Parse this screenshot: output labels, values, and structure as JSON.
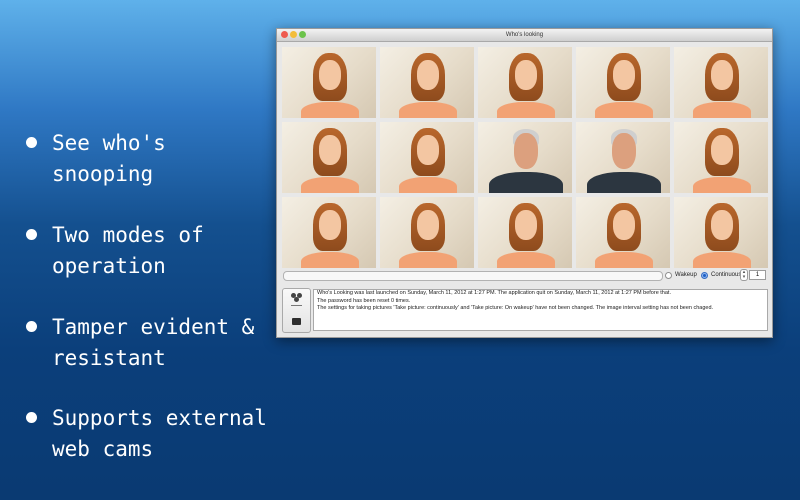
{
  "features": [
    {
      "text": "See who's\nsnooping"
    },
    {
      "text": "Two modes of\noperation"
    },
    {
      "text": "Tamper evident &\nresistant"
    },
    {
      "text": "Supports external\nweb cams"
    }
  ],
  "window": {
    "title": "Who's looking",
    "controls": {
      "wakeup_label": "Wakeup",
      "continuous_label": "Continuous",
      "selected_mode": "Continuous",
      "interval": "1"
    },
    "log": [
      "Who's Looking was last launched on Sunday, March 11, 2012 at 1:27 PM.  The application quit on Sunday, March 11, 2012 at 1:27 PM before that.",
      "The password has been reset 0 times.",
      "The settings for taking pictures 'Take picture: continuously' and 'Take picture: On wakeup' have not been changed. The image interval setting has not been chaged."
    ]
  },
  "photos": [
    "woman",
    "woman",
    "woman",
    "woman",
    "woman",
    "woman",
    "woman",
    "man",
    "man",
    "woman",
    "woman",
    "woman",
    "woman",
    "woman",
    "woman"
  ],
  "colors": {
    "bg_top": "#5fb1ea",
    "bg_bottom": "#0a3a72",
    "bullet_text": "#ffffff",
    "radio_selected": "#1e62c9"
  },
  "icons": [
    "close-icon",
    "minimize-icon",
    "zoom-icon",
    "camera-cluster-icon",
    "lock-icon",
    "stepper-icon"
  ]
}
